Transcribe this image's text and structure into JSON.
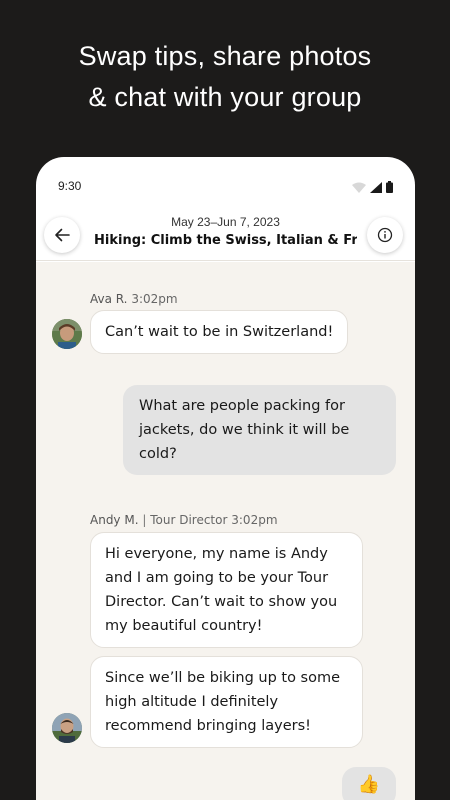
{
  "promo": {
    "line1": "Swap tips, share photos",
    "line2": "& chat with your group"
  },
  "status_bar": {
    "time": "9:30",
    "icons": [
      "wifi-icon",
      "signal-icon",
      "battery-icon"
    ]
  },
  "header": {
    "date_range": "May 23–Jun 7, 2023",
    "title": "Hiking: Climb the Swiss, Italian & Fren...",
    "back_icon": "arrow-left-icon",
    "info_icon": "info-icon"
  },
  "messages": [
    {
      "sender": "Ava R.",
      "role": "",
      "time": "3:02pm",
      "direction": "incoming",
      "text": "Can’t wait to be in Switzerland!"
    },
    {
      "direction": "outgoing",
      "text": "What are people packing for jackets, do we think it will be cold?"
    },
    {
      "sender": "Andy M.",
      "role": "Tour Director",
      "time": "3:02pm",
      "direction": "incoming",
      "text": "Hi everyone, my name is Andy and I am going to be your Tour Director. Can’t wait to show you my beautiful country!"
    },
    {
      "direction": "incoming",
      "text": "Since we’ll be biking up to some high altitude I definitely recommend bringing layers!"
    },
    {
      "direction": "outgoing",
      "text": "👍"
    }
  ],
  "colors": {
    "background": "#1c1b1a",
    "chat_background": "#f6f3ee",
    "incoming_bubble": "#ffffff",
    "outgoing_bubble": "#e3e3e3"
  }
}
